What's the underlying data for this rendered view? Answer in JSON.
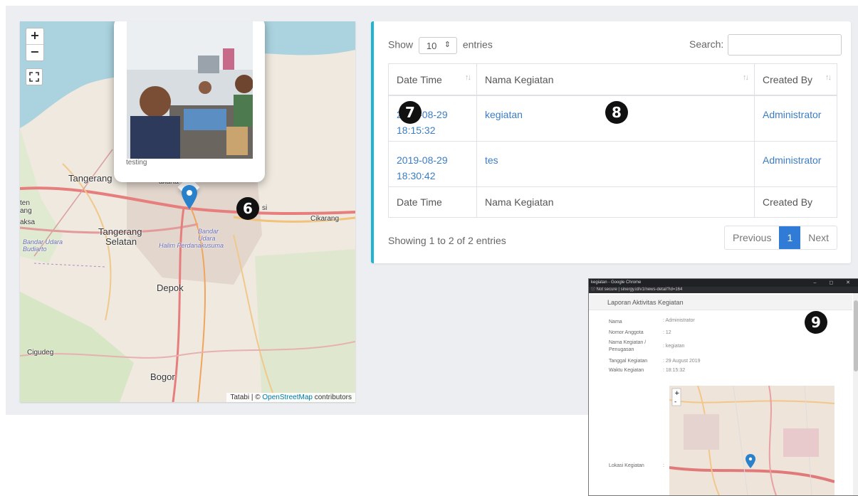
{
  "map": {
    "zoom_in": "+",
    "zoom_out": "−",
    "popup_caption": "testing",
    "labels": {
      "tangerang": "Tangerang",
      "tangerang_selatan_1": "Tangerang",
      "tangerang_selatan_2": "Selatan",
      "depok": "Depok",
      "bogor": "Bogor",
      "cigudeg": "Cigudeg",
      "cikarang": "Cikarang",
      "halim": "Halim Perdanakusuma",
      "bandar_udara": "Bandar Udara",
      "budiarto": "Bandar Udara Budiarto",
      "bekasi_tail": "si",
      "jakarta_tail": "akarta",
      "ten": "ten",
      "ang": "ang",
      "aksa": "aksa"
    },
    "attribution_prefix": "Tatabi | ©",
    "attribution_link": "OpenStreetMap",
    "attribution_suffix": "contributors"
  },
  "badges": {
    "b6": "6",
    "b7": "7",
    "b8": "8",
    "b9": "9"
  },
  "table": {
    "show_label": "Show",
    "entries_value": "10",
    "entries_label": "entries",
    "search_label": "Search:",
    "search_value": "",
    "columns": [
      "Date Time",
      "Nama Kegiatan",
      "Created By"
    ],
    "rows": [
      {
        "date": "2019-08-29",
        "time": "18:15:32",
        "nama": "kegiatan",
        "created_by": "Administrator"
      },
      {
        "date": "2019-08-29",
        "time": "18:30:42",
        "nama": "tes",
        "created_by": "Administrator"
      }
    ],
    "footer": [
      "Date Time",
      "Nama Kegiatan",
      "Created By"
    ],
    "info": "Showing 1 to 2 of 2 entries",
    "pager": {
      "previous": "Previous",
      "current": "1",
      "next": "Next"
    }
  },
  "inset": {
    "window_title": "kegiatan - Google Chrome",
    "window_controls": "–  ◻  ✕",
    "url": "ⓘ  Not secure  |  sinergy.id/v1/news-detail?id=164",
    "header": "Laporan Aktivitas Kegiatan",
    "fields": [
      {
        "label": "Nama",
        "value": ": Administrator"
      },
      {
        "label": "Nomor Anggota",
        "value": ": 12"
      },
      {
        "label": "Nama Kegiatan /",
        "value": ": kegiatan"
      },
      {
        "label": "Penugasan",
        "value": ""
      },
      {
        "label": "Tanggal Kegiatan",
        "value": ": 29 August 2019"
      },
      {
        "label": "Waktu Kegiatan",
        "value": ": 18:15:32"
      },
      {
        "label": "Lokasi Kegiatan",
        "value": ":"
      }
    ]
  }
}
